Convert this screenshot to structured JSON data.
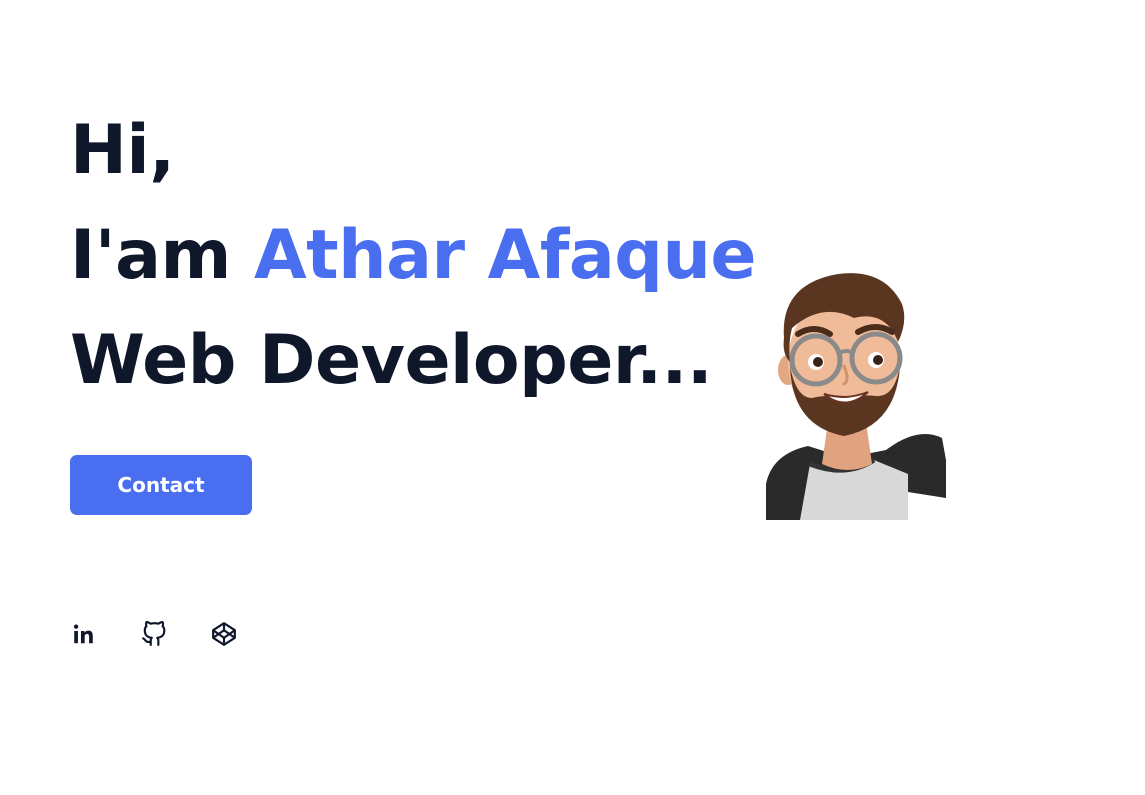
{
  "hero": {
    "greeting": "Hi,",
    "intro_prefix": "I'am ",
    "name": "Athar Afaque",
    "role": "Web Developer..."
  },
  "contact_button": {
    "label": "Contact"
  },
  "social": [
    {
      "icon": "linkedin-icon"
    },
    {
      "icon": "github-icon"
    },
    {
      "icon": "codepen-icon"
    }
  ],
  "colors": {
    "text": "#0f172a",
    "accent": "#4a6ef0",
    "background": "#ffffff"
  }
}
